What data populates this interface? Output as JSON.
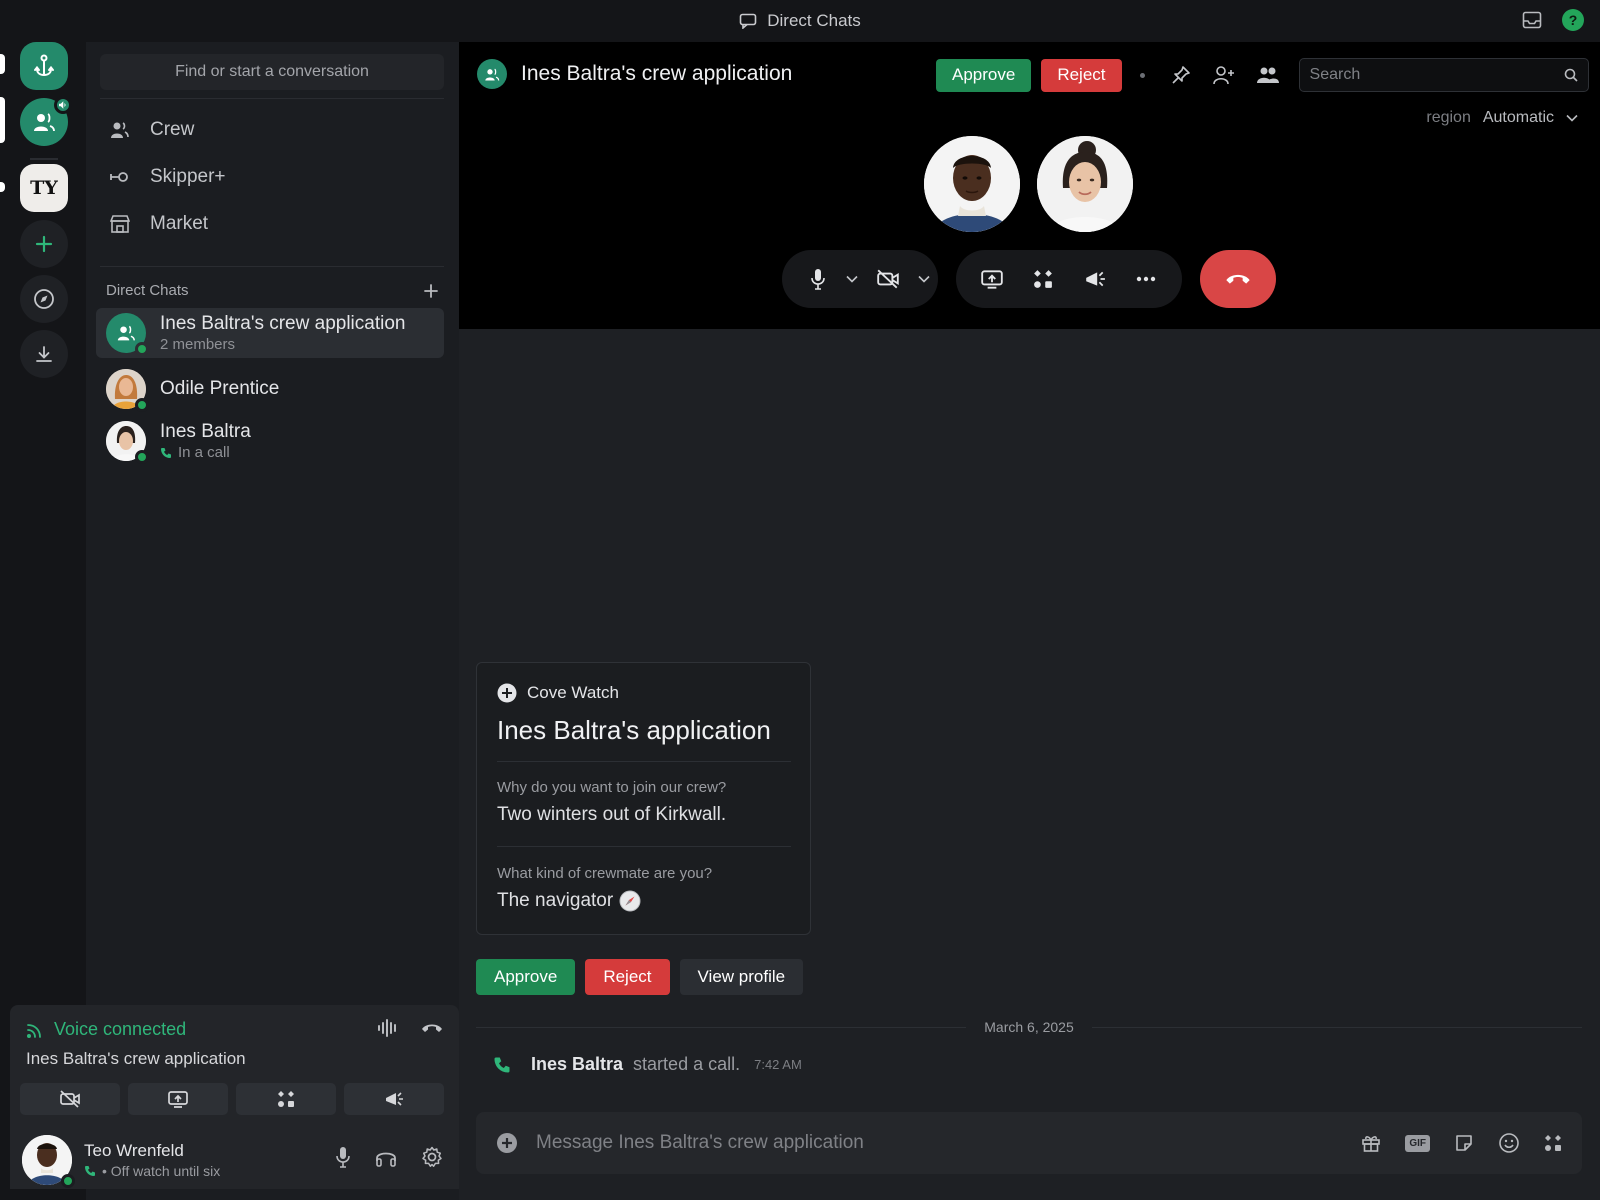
{
  "titlebar": {
    "title": "Direct Chats"
  },
  "sidebar": {
    "search_placeholder": "Find or start a conversation",
    "nav": [
      {
        "label": "Crew",
        "icon": "people-icon"
      },
      {
        "label": "Skipper+",
        "icon": "key-icon"
      },
      {
        "label": "Market",
        "icon": "store-icon"
      }
    ],
    "section_title": "Direct Chats",
    "dms": [
      {
        "name": "Ines Baltra's crew application",
        "sub": "2 members",
        "active": true
      },
      {
        "name": "Odile Prentice",
        "sub": ""
      },
      {
        "name": "Ines Baltra",
        "sub": "In a call"
      }
    ]
  },
  "rail": {
    "server_initials": "TY"
  },
  "voice": {
    "status": "Voice connected",
    "room": "Ines Baltra's crew application"
  },
  "user": {
    "name": "Teo Wrenfeld",
    "status": "• Off watch until six"
  },
  "header": {
    "title": "Ines Baltra's crew application",
    "approve": "Approve",
    "reject": "Reject",
    "search_placeholder": "Search",
    "region_label": "region",
    "region_value": "Automatic"
  },
  "card": {
    "source": "Cove Watch",
    "title": "Ines Baltra's application",
    "q1": "Why do you want to join our crew?",
    "a1": "Two winters out of Kirkwall.",
    "q2": "What kind of crewmate are you?",
    "a2": "The navigator",
    "approve": "Approve",
    "reject": "Reject",
    "view_profile": "View profile"
  },
  "timeline": {
    "date": "March 6, 2025",
    "event_who": "Ines Baltra",
    "event_what": "started a call.",
    "event_time": "7:42 AM"
  },
  "composer": {
    "placeholder": "Message Ines Baltra's crew application"
  },
  "colors": {
    "accent": "#248a6b",
    "approve": "#1f8a53",
    "reject": "#d53b3b",
    "online": "#23a55a"
  }
}
